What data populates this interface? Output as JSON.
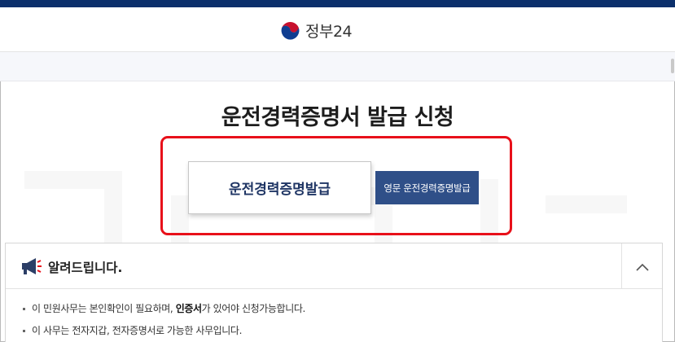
{
  "header": {
    "logo_text": "정부24",
    "logo_icon": "taegeuk-emblem-icon"
  },
  "page": {
    "title": "운전경력증명서 발급 신청"
  },
  "actions": {
    "primary_label": "운전경력증명발급",
    "secondary_label": "영문 운전경력증명발급"
  },
  "notice": {
    "title": "알려드립니다.",
    "icon": "megaphone-icon",
    "toggle_icon": "chevron-up-icon",
    "items": [
      {
        "pre": "이 민원사무는 본인확인이 필요하며, ",
        "bold": "인증서",
        "post": "가 있어야 신청가능합니다."
      },
      {
        "pre": "이 사무는 전자지갑, 전자증명서로 가능한 사무입니다.",
        "bold": "",
        "post": ""
      }
    ]
  },
  "colors": {
    "top_bar": "#0b2f6b",
    "highlight": "#e8101a",
    "secondary_button": "#2f4f88",
    "primary_text": "#1f3564"
  }
}
